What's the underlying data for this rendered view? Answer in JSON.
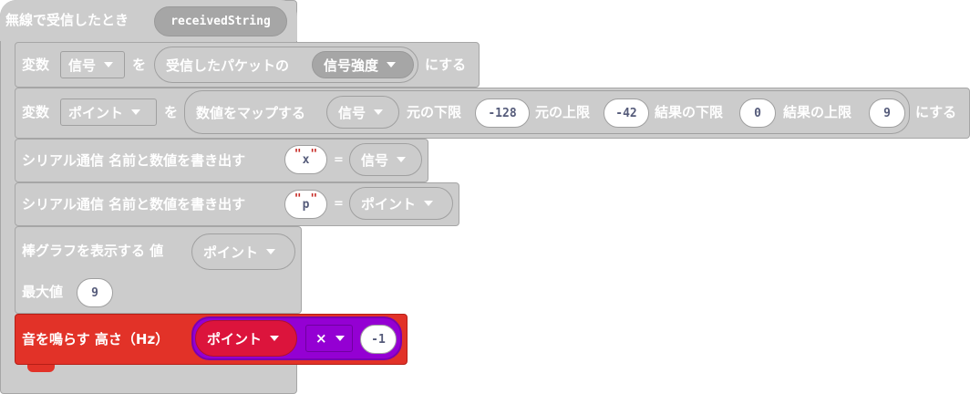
{
  "event": {
    "label": "無線で受信したとき",
    "param": "receivedString"
  },
  "set1": {
    "kw": "変数",
    "var": "信号",
    "mid": "を",
    "label": "受信したパケットの",
    "prop": "信号強度",
    "end": "にする"
  },
  "set2": {
    "kw": "変数",
    "var": "ポイント",
    "mid": "を",
    "map": "数値をマップする",
    "src": "信号",
    "fromLow_label": "元の下限",
    "fromLow": "-128",
    "fromHigh_label": "元の上限",
    "fromHigh": "-42",
    "toLow_label": "結果の下限",
    "toLow": "0",
    "toHigh_label": "結果の上限",
    "toHigh": "9",
    "end": "にする"
  },
  "serial1": {
    "label": "シリアル通信 名前と数値を書き出す",
    "name": "x",
    "eq": "=",
    "value": "信号"
  },
  "serial2": {
    "label": "シリアル通信 名前と数値を書き出す",
    "name": "p",
    "eq": "=",
    "value": "ポイント"
  },
  "bar": {
    "label": "棒グラフを表示する 値",
    "value": "ポイント",
    "max_label": "最大値",
    "max": "9"
  },
  "tone": {
    "label": "音を鳴らす 高さ（Hz）",
    "var": "ポイント",
    "op": "×",
    "operand": "-1"
  },
  "colors": {
    "event": "#cccccc",
    "music": "#e23228",
    "math": "#9400d3",
    "variable": "#dc143c"
  }
}
